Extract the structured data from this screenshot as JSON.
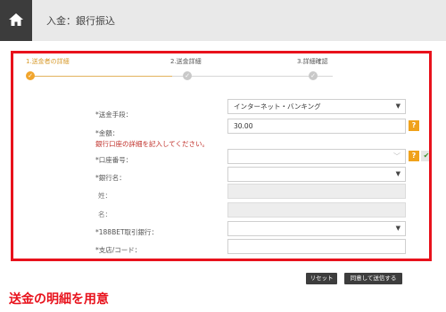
{
  "header": {
    "title": "入金：銀行振込",
    "home_icon": "home-icon"
  },
  "steps": [
    {
      "label": "1.送金者の詳細",
      "state": "active"
    },
    {
      "label": "2.送金詳細",
      "state": "inactive"
    },
    {
      "label": "3.詳細確認",
      "state": "inactive"
    }
  ],
  "form": {
    "method": {
      "label": "*送金手段：",
      "value": "インターネット・バンキング"
    },
    "amount": {
      "label": "*金額：",
      "value": "30.00",
      "help": "?"
    },
    "notice": "銀行口座の詳細を記入してください。",
    "account_no": {
      "label": "*口座番号：",
      "help": "?",
      "ok": "✔",
      "trailing_text": "既存"
    },
    "bank_name": {
      "label": "*銀行名："
    },
    "last_name": {
      "label": "姓："
    },
    "first_name": {
      "label": "名："
    },
    "bank_188": {
      "label": "*188BET取引銀行："
    },
    "branch_code": {
      "label": "*支店/コード："
    }
  },
  "buttons": {
    "reset": "リセット",
    "submit": "同意して送信する"
  },
  "caption": "送金の明細を用意",
  "colors": {
    "accent": "#f0a21b",
    "frame": "#e8121c",
    "button": "#3d3d3d"
  }
}
